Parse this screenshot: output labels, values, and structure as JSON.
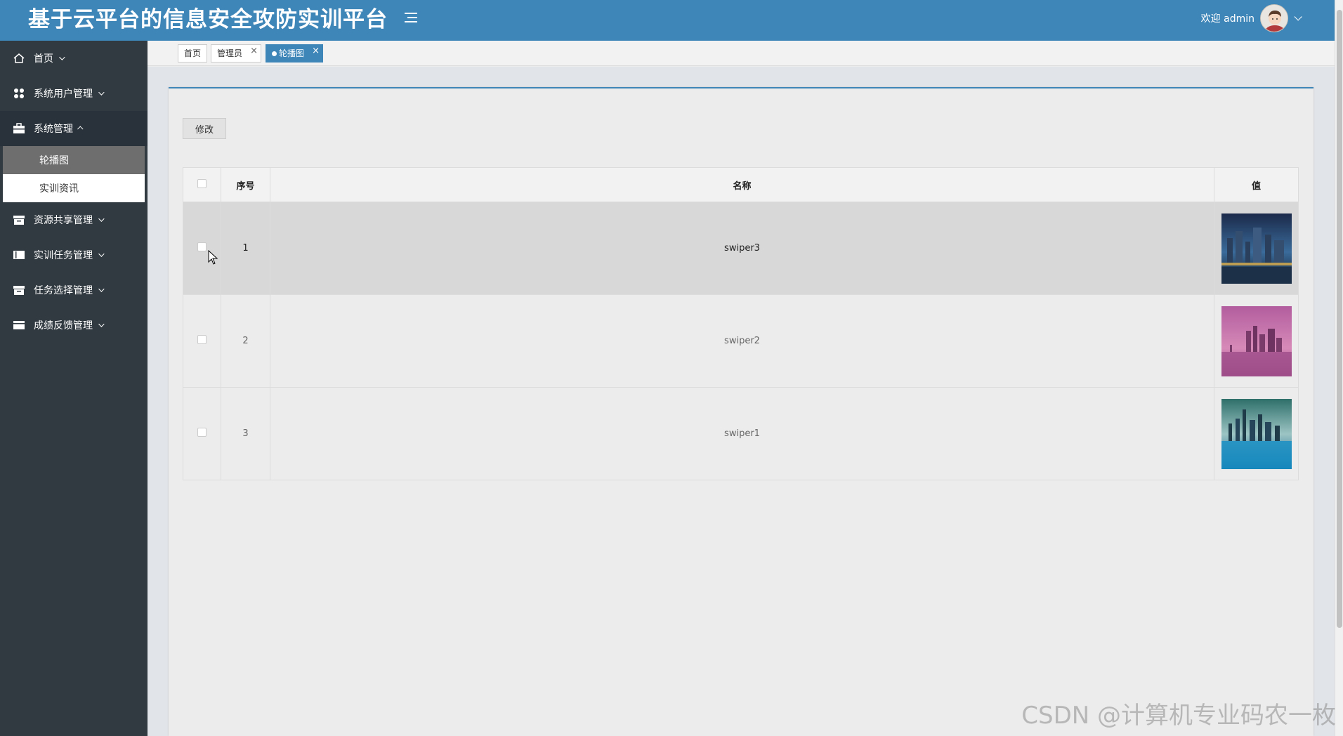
{
  "header": {
    "title": "基于云平台的信息安全攻防实训平台",
    "welcome": "欢迎 admin",
    "bg_color": "#3f86b8"
  },
  "sidebar": {
    "items": [
      {
        "label": "首页",
        "icon": "home-icon"
      },
      {
        "label": "系统用户管理",
        "icon": "grid-icon"
      },
      {
        "label": "系统管理",
        "icon": "briefcase-icon",
        "expanded": true,
        "children": [
          {
            "label": "轮播图",
            "active": true
          },
          {
            "label": "实训资讯"
          }
        ]
      },
      {
        "label": "资源共享管理",
        "icon": "archive-icon"
      },
      {
        "label": "实训任务管理",
        "icon": "book-icon"
      },
      {
        "label": "任务选择管理",
        "icon": "archive-icon"
      },
      {
        "label": "成绩反馈管理",
        "icon": "list-icon"
      }
    ]
  },
  "tabs": [
    {
      "label": "首页"
    },
    {
      "label": "管理员",
      "closable": true
    },
    {
      "label": "轮播图",
      "closable": true,
      "active": true
    }
  ],
  "toolbar": {
    "edit_label": "修改"
  },
  "table": {
    "headers": [
      "序号",
      "名称",
      "值"
    ],
    "rows": [
      {
        "index": "1",
        "name": "swiper3",
        "image": "city-night-image"
      },
      {
        "index": "2",
        "name": "swiper2",
        "image": "city-pink-image"
      },
      {
        "index": "3",
        "name": "swiper1",
        "image": "city-teal-image"
      }
    ]
  },
  "watermark": "CSDN @计算机专业码农一枚"
}
